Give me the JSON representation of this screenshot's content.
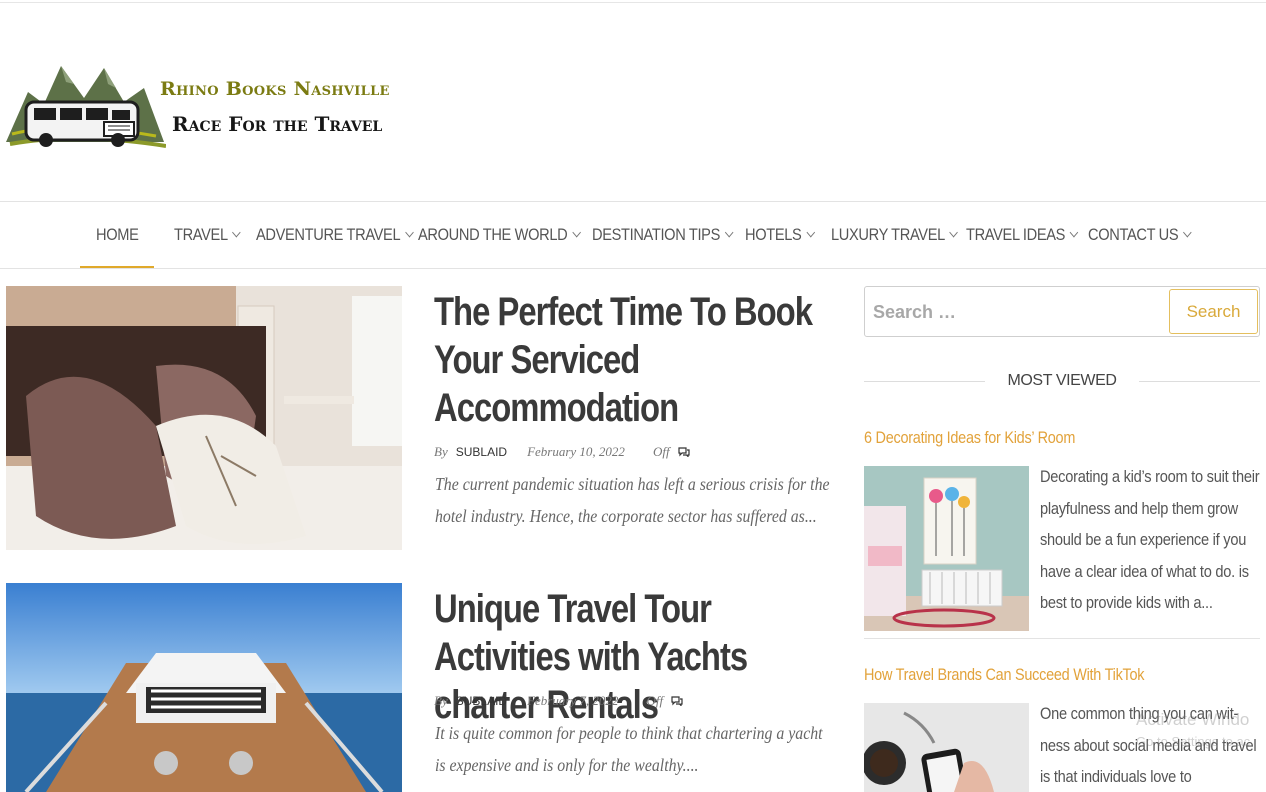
{
  "site": {
    "name_line1": "Rhino Books Nashville",
    "name_line2": "Race For the Travel"
  },
  "nav": {
    "items": [
      {
        "label": "HOME",
        "active": true,
        "dropdown": false
      },
      {
        "label": "TRAVEL",
        "dropdown": true
      },
      {
        "label": "ADVENTURE TRAVEL",
        "dropdown": true
      },
      {
        "label": "AROUND THE WORLD",
        "dropdown": true
      },
      {
        "label": "DESTINATION TIPS",
        "dropdown": true
      },
      {
        "label": "HOTELS",
        "dropdown": true
      },
      {
        "label": "LUXURY TRAVEL",
        "dropdown": true
      },
      {
        "label": "TRAVEL IDEAS",
        "dropdown": true
      },
      {
        "label": "CONTACT US",
        "dropdown": true
      }
    ]
  },
  "posts": [
    {
      "title": "The Perfect Time To Book Your Serviced Accommodation",
      "by": "By",
      "author": "SUBLAID",
      "date": "February 10, 2022",
      "comments": "Off",
      "excerpt": "The current pandemic situation has left a serious crisis for the hotel industry. Hence, the corporate sector has suffered as..."
    },
    {
      "title": "Unique Travel Tour Activities with Yachts charter Rentals",
      "by": "By",
      "author": "SUBLAID",
      "date": "February 7, 2022",
      "comments": "Off",
      "excerpt": "It is quite common for people to think that chartering a yacht is expensive and is only for the wealthy...."
    }
  ],
  "sidebar": {
    "search": {
      "placeholder": "Search …",
      "button_label": "Search"
    },
    "most_viewed_title": "MOST VIEWED",
    "most_viewed": [
      {
        "title": "6 Decorating Ideas for Kids’ Room",
        "excerpt": "Decorating a kid’s room to suit their playfulness and help them grow should be a fun experience if you have a clear idea of what to do. is best to provide kids with a..."
      },
      {
        "title": "How Travel Brands Can Succeed With TikTok",
        "excerpt": "One common thing you can wit-ness about social media and travel is that individuals love to"
      }
    ]
  },
  "os_overlay": {
    "line1": "Activate Windo",
    "line2": "Go to Settings to ac"
  },
  "colors": {
    "accent": "#e0a92b",
    "link": "#e2a23a",
    "logo_olive": "#7b7b12"
  }
}
